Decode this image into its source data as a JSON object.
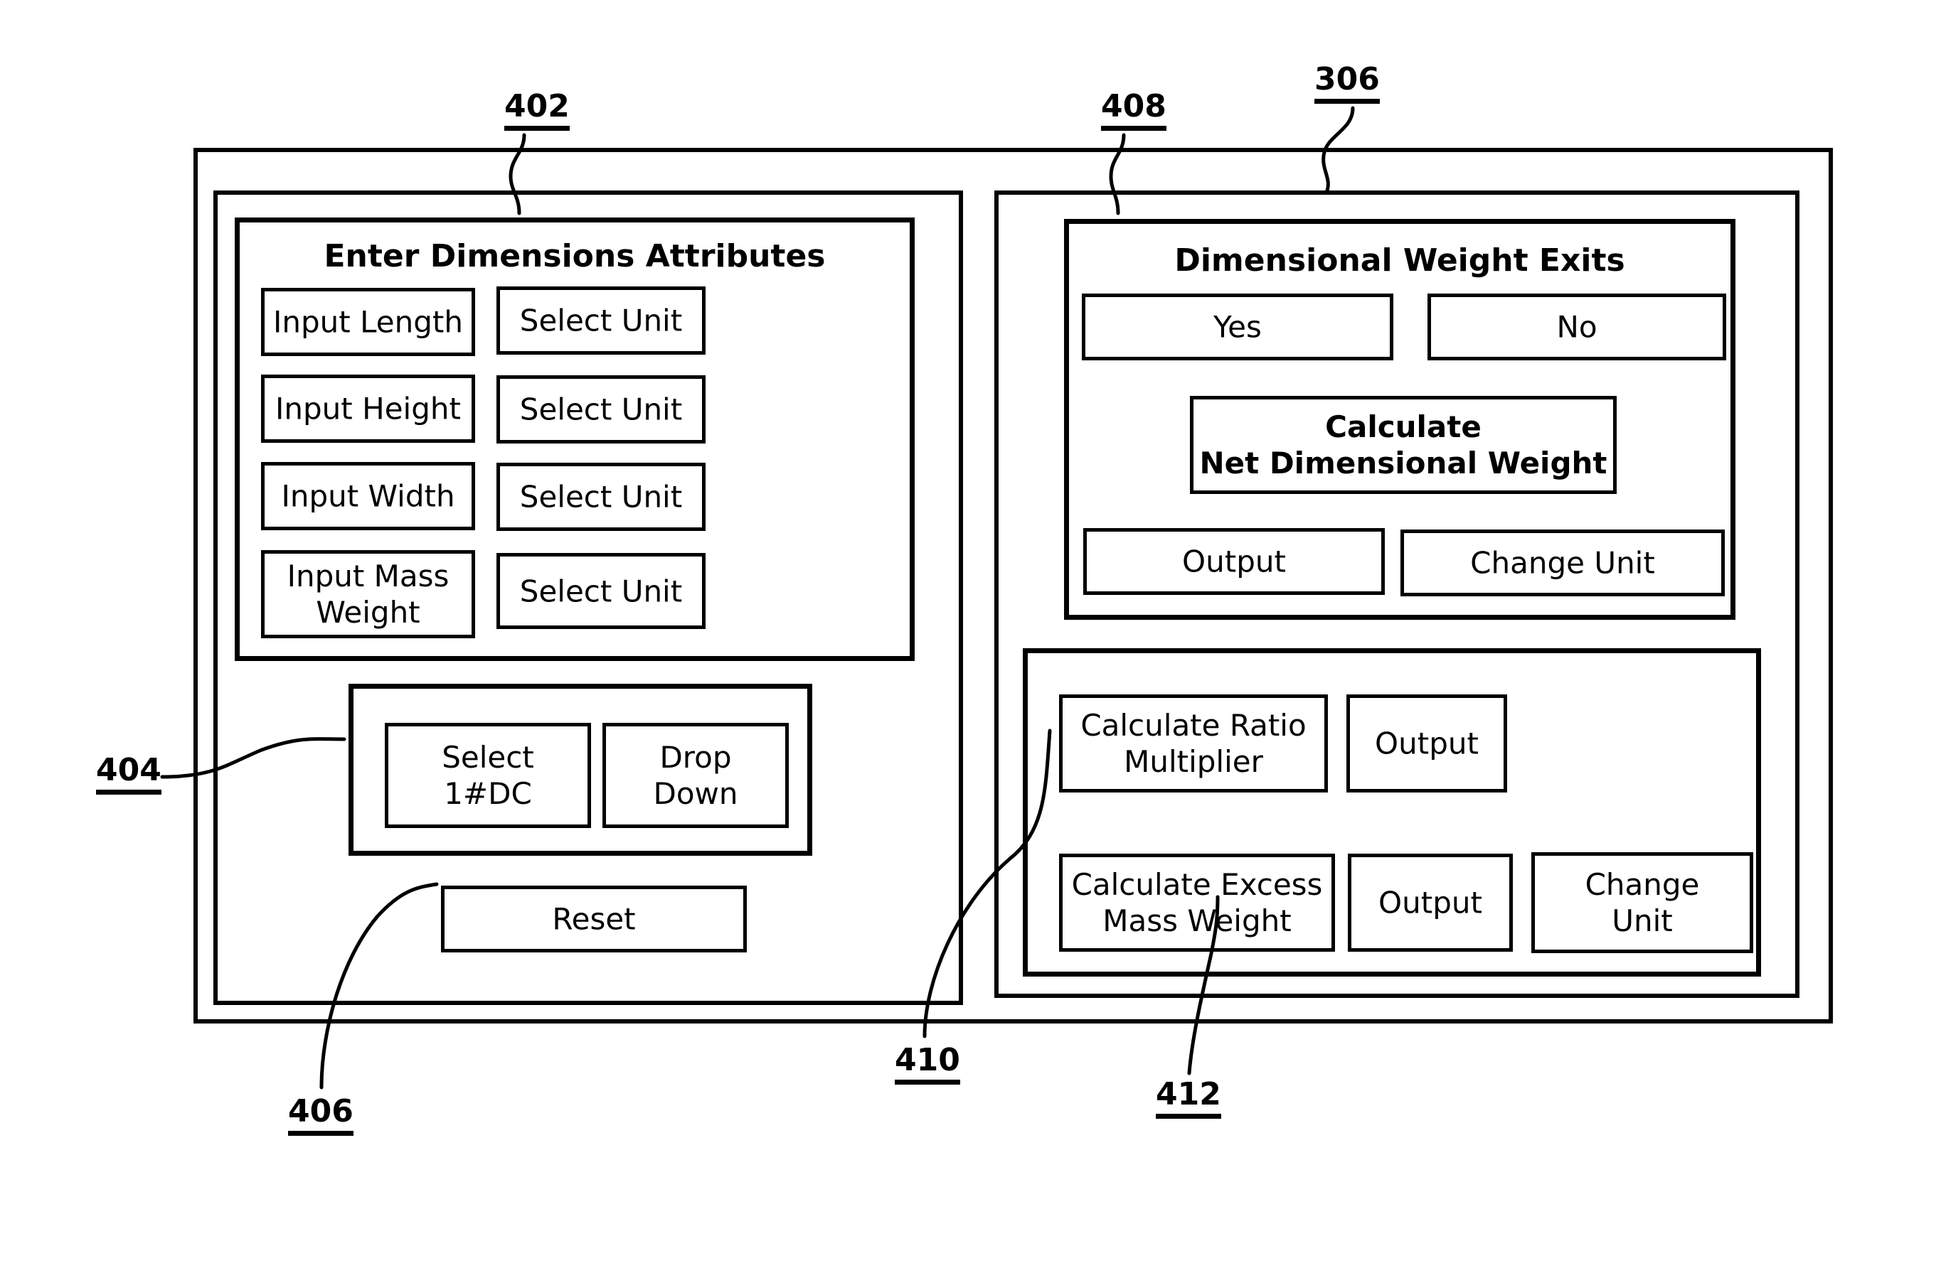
{
  "figure": {
    "reference_numerals": [
      {
        "id": "402",
        "label": "402"
      },
      {
        "id": "408",
        "label": "408"
      },
      {
        "id": "306",
        "label": "306"
      },
      {
        "id": "404",
        "label": "404"
      },
      {
        "id": "406",
        "label": "406"
      },
      {
        "id": "410",
        "label": "410"
      },
      {
        "id": "412",
        "label": "412"
      }
    ]
  },
  "left_panel": {
    "ref": "402",
    "dimensions_group": {
      "title": "Enter Dimensions Attributes",
      "rows": [
        {
          "input_label": "Input Length",
          "unit_label": "Select Unit"
        },
        {
          "input_label": "Input Height",
          "unit_label": "Select Unit"
        },
        {
          "input_label": "Input Width",
          "unit_label": "Select Unit"
        },
        {
          "input_label": "Input Mass\nWeight",
          "unit_label": "Select Unit"
        }
      ]
    },
    "selector_group": {
      "ref": "404",
      "select_label": "Select\n1#DC",
      "dropdown_label": "Drop\nDown"
    },
    "reset_button": {
      "ref": "406",
      "label": "Reset"
    }
  },
  "right_panel": {
    "ref": "408",
    "outer_ref": "306",
    "exits_group": {
      "title": "Dimensional Weight Exits",
      "yes_label": "Yes",
      "no_label": "No",
      "calculate_label": "Calculate\nNet Dimensional Weight",
      "output_label": "Output",
      "change_unit_label": "Change Unit"
    },
    "ratio_group": {
      "ref": "410",
      "ref_excess": "412",
      "row1": {
        "action_label": "Calculate Ratio\nMultiplier",
        "output_label": "Output"
      },
      "row2": {
        "action_label": "Calculate Excess\nMass Weight",
        "output_label": "Output",
        "change_unit_label": "Change\nUnit"
      }
    }
  },
  "style": {
    "stroke": "#000000",
    "background": "#ffffff"
  }
}
